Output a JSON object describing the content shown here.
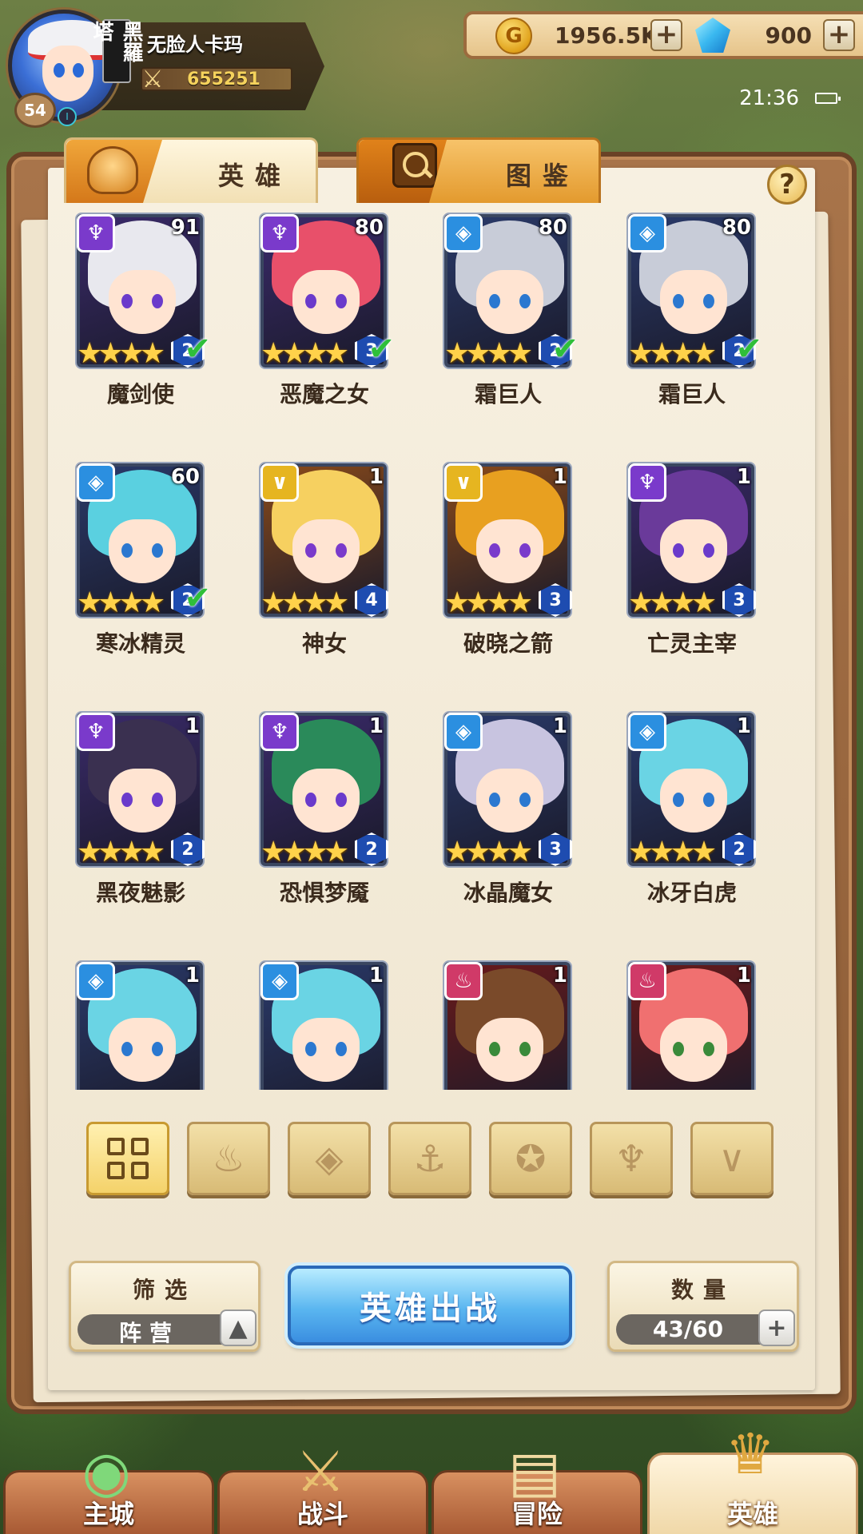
{
  "player": {
    "name": "无脸人卡玛",
    "level": "54",
    "power": "655251",
    "guild_tag": "黑羅塔",
    "vip": "Ⅰ"
  },
  "currency": {
    "gold": "1956.5K",
    "gems": "900",
    "plus": "+"
  },
  "status": {
    "time": "21:36"
  },
  "tabs": {
    "heroes": "英雄",
    "gallery": "图鉴",
    "help": "?"
  },
  "colors": {
    "purple": "#7a3acb",
    "blue": "#2b8fe0",
    "gold": "#e6b520",
    "red": "#d03a68"
  },
  "heroes": [
    {
      "name": "魔剑使",
      "level": "91",
      "faction": "purple",
      "stars": 4,
      "rank": "2",
      "deployed": true
    },
    {
      "name": "恶魔之女",
      "level": "80",
      "faction": "purple",
      "stars": 4,
      "rank": "3",
      "deployed": true
    },
    {
      "name": "霜巨人",
      "level": "80",
      "faction": "blue",
      "stars": 4,
      "rank": "2",
      "deployed": true
    },
    {
      "name": "霜巨人",
      "level": "80",
      "faction": "blue",
      "stars": 4,
      "rank": "2",
      "deployed": true
    },
    {
      "name": "寒冰精灵",
      "level": "60",
      "faction": "blue",
      "stars": 4,
      "rank": "2",
      "deployed": true
    },
    {
      "name": "神女",
      "level": "1",
      "faction": "gold",
      "stars": 4,
      "rank": "4",
      "deployed": false
    },
    {
      "name": "破晓之箭",
      "level": "1",
      "faction": "gold",
      "stars": 4,
      "rank": "3",
      "deployed": false
    },
    {
      "name": "亡灵主宰",
      "level": "1",
      "faction": "purple",
      "stars": 4,
      "rank": "3",
      "deployed": false
    },
    {
      "name": "黑夜魅影",
      "level": "1",
      "faction": "purple",
      "stars": 4,
      "rank": "2",
      "deployed": false
    },
    {
      "name": "恐惧梦魇",
      "level": "1",
      "faction": "purple",
      "stars": 4,
      "rank": "2",
      "deployed": false
    },
    {
      "name": "冰晶魔女",
      "level": "1",
      "faction": "blue",
      "stars": 4,
      "rank": "3",
      "deployed": false
    },
    {
      "name": "冰牙白虎",
      "level": "1",
      "faction": "blue",
      "stars": 4,
      "rank": "2",
      "deployed": false
    },
    {
      "name": "",
      "level": "1",
      "faction": "blue",
      "stars": 0,
      "rank": "",
      "deployed": false
    },
    {
      "name": "",
      "level": "1",
      "faction": "blue",
      "stars": 0,
      "rank": "",
      "deployed": false
    },
    {
      "name": "",
      "level": "1",
      "faction": "red",
      "stars": 0,
      "rank": "",
      "deployed": false
    },
    {
      "name": "",
      "level": "1",
      "faction": "red",
      "stars": 0,
      "rank": "",
      "deployed": false
    }
  ],
  "filters": [
    {
      "name": "all-filter",
      "icon": "grid-icon",
      "active": true
    },
    {
      "name": "faction-flame-filter",
      "icon": "flame-icon",
      "active": false
    },
    {
      "name": "faction-ice-filter",
      "icon": "ice-crystal-icon",
      "active": false
    },
    {
      "name": "faction-anchor-filter",
      "icon": "anchor-icon",
      "active": false
    },
    {
      "name": "faction-beast-filter",
      "icon": "wolf-head-icon",
      "active": false
    },
    {
      "name": "faction-demon-filter",
      "icon": "demon-horns-icon",
      "active": false
    },
    {
      "name": "faction-holy-filter",
      "icon": "wings-icon",
      "active": false
    }
  ],
  "controls": {
    "filter_title": "筛选",
    "filter_value": "阵营",
    "deploy": "英雄出战",
    "count_title": "数量",
    "count_value": "43/60"
  },
  "nav": {
    "city": "主城",
    "battle": "战斗",
    "adventure": "冒险",
    "heroes": "英雄"
  }
}
